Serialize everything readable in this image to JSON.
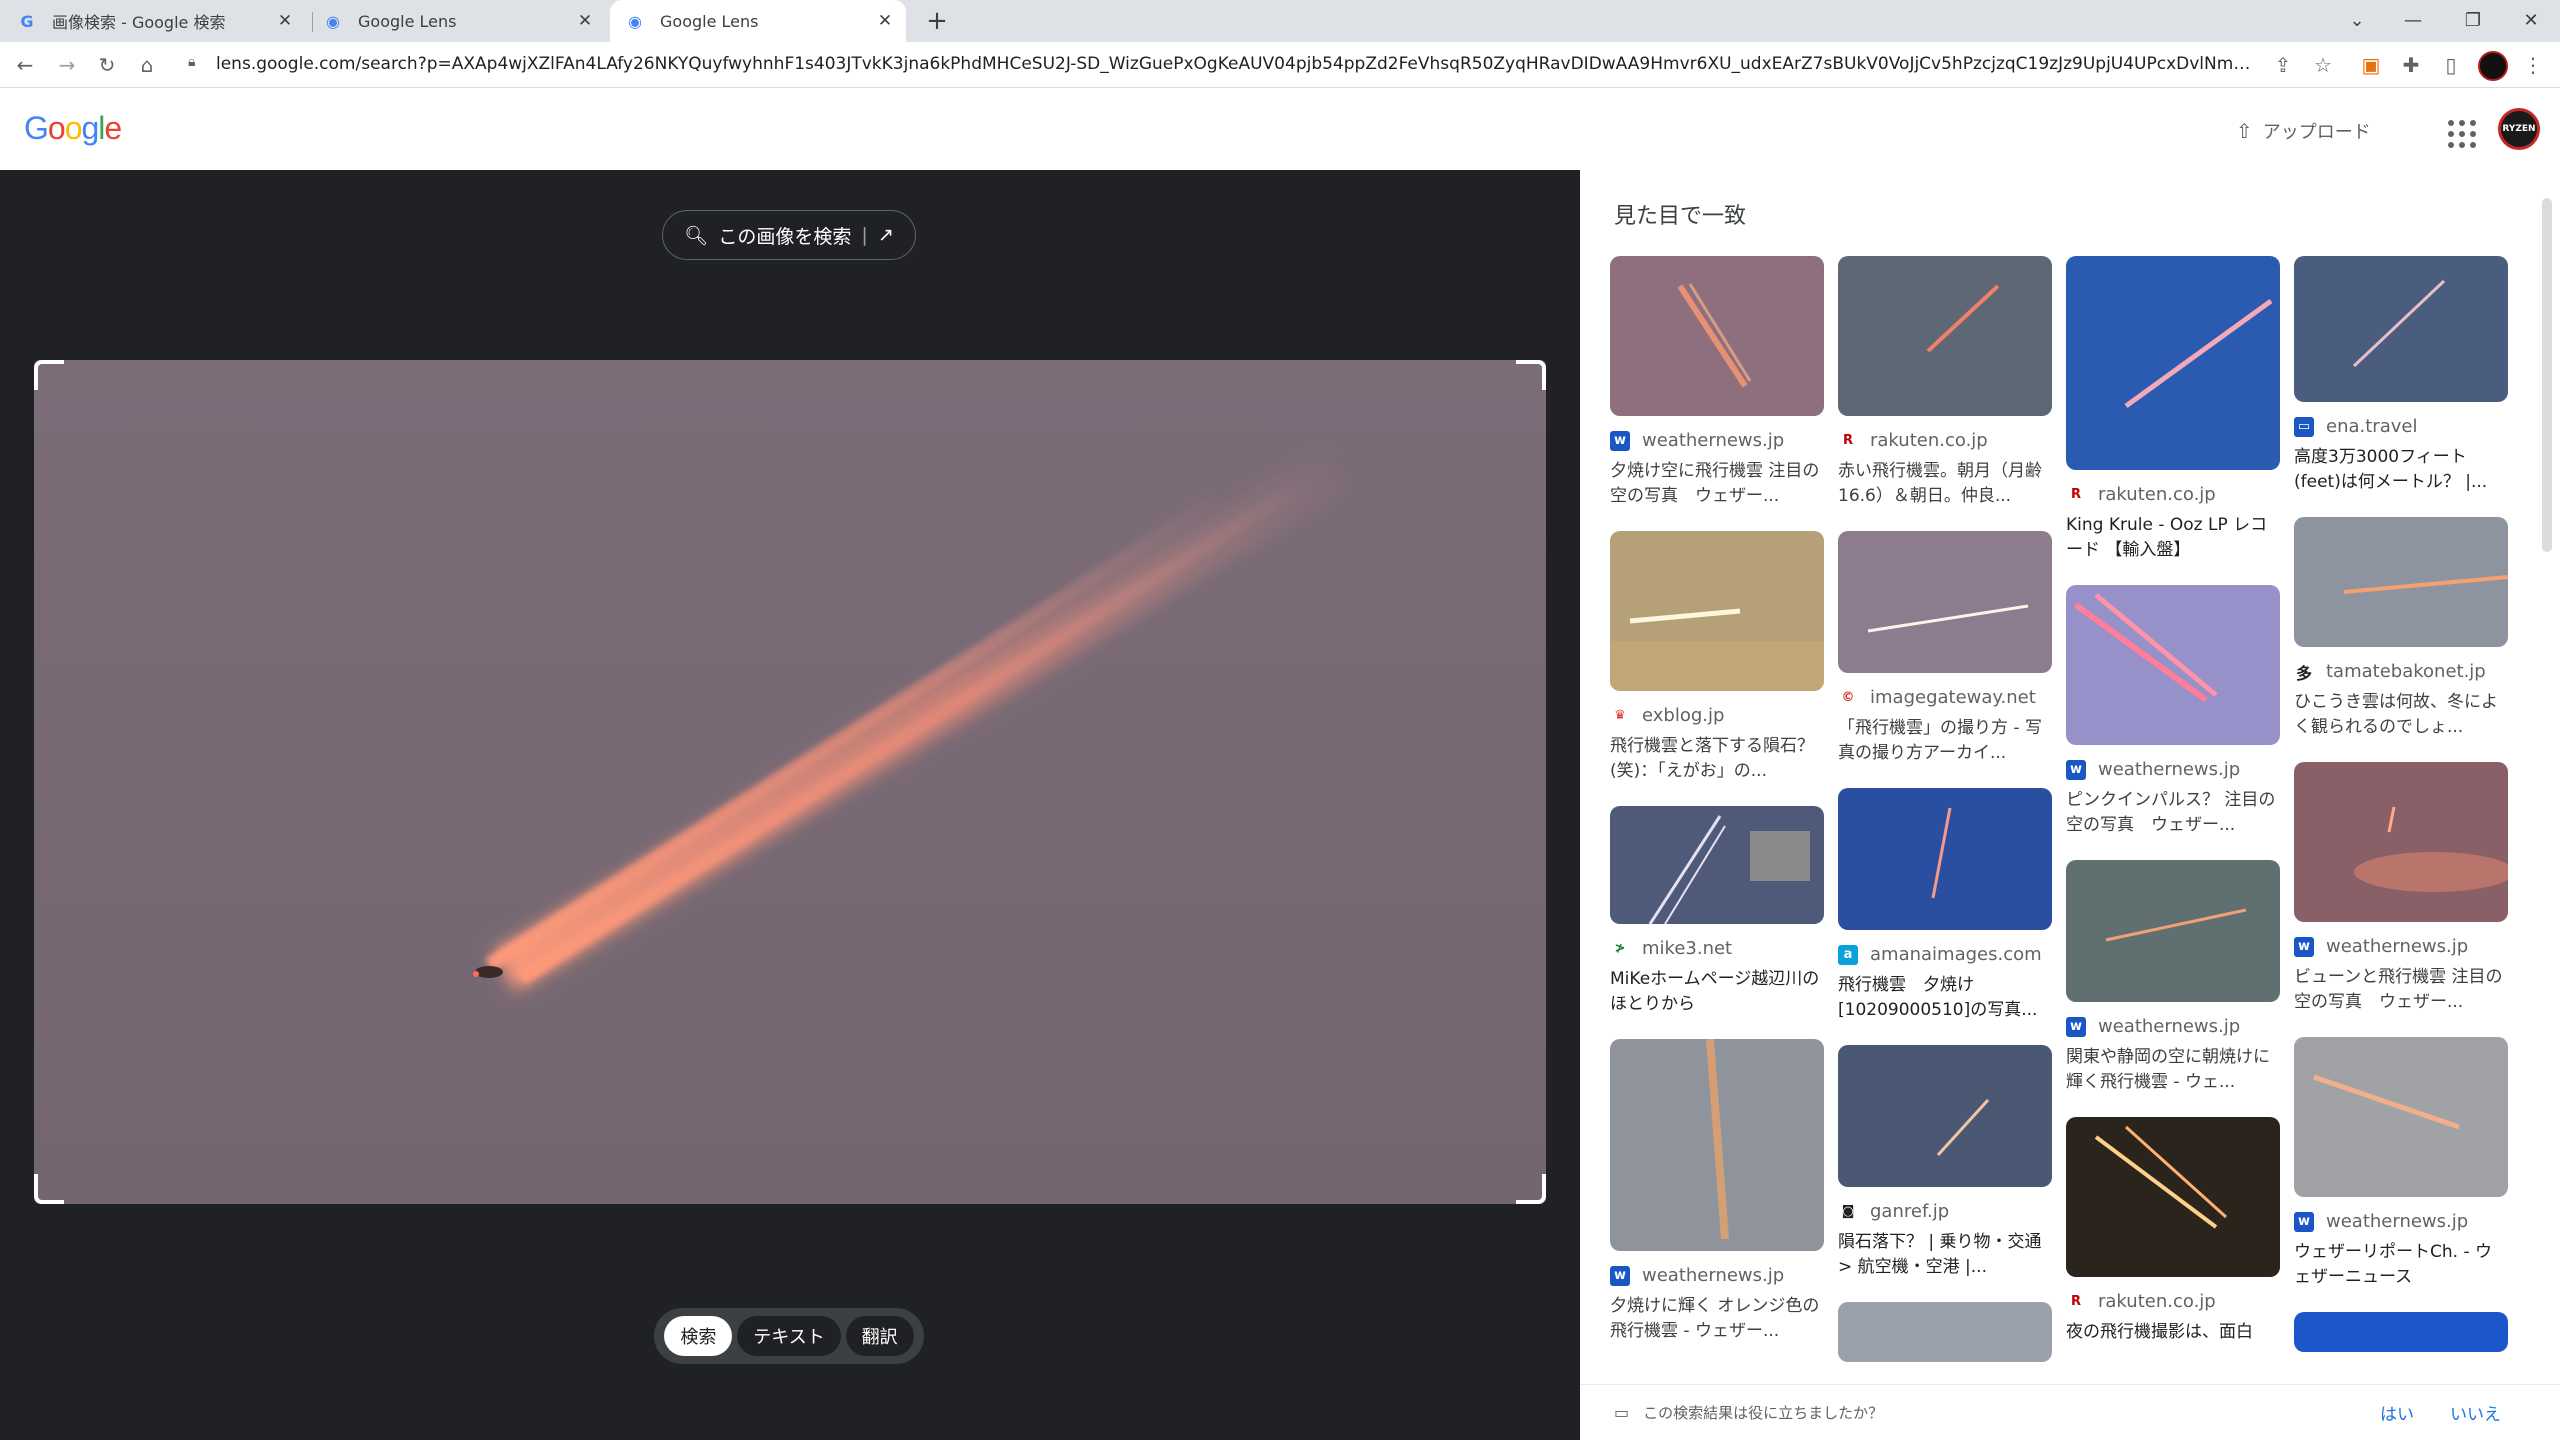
{
  "browser": {
    "tabs": [
      {
        "title": "画像検索 - Google 検索",
        "favicon": "G"
      },
      {
        "title": "Google Lens",
        "favicon": "◉"
      },
      {
        "title": "Google Lens",
        "favicon": "◉"
      }
    ],
    "address": "lens.google.com/search?p=AXAp4wjXZlFAn4LAfy26NKYQuyfwyhnhF1s403JTvkK3jna6kPhdMHCeSU2J-SD_WizGuePxOgKeAUV04pjb54ppZd2FeVhsqR50ZyqHRavDIDwAA9Hmvr6XU_udxEArZ7sBUkV0VoJjCv5hPzcjzqC19zJz9UpjU4UPcxDvlNmuyx4eRPT2EtqiG4bDJu..."
  },
  "header": {
    "logo": "Google",
    "upload_label": "アップロード"
  },
  "viewer": {
    "search_image_label": "この画像を検索",
    "modes": [
      "検索",
      "テキスト",
      "翻訳"
    ]
  },
  "results": {
    "title": "見た目で一致",
    "columns": [
      [
        {
          "source": "weathernews.jp",
          "title": "夕焼け空に飛行機雲 注目の空の写真　ウェザー..."
        },
        {
          "source": "exblog.jp",
          "title": "飛行機雲と落下する隕石？(笑)：「えがお」の..."
        },
        {
          "source": "mike3.net",
          "title": "MiKeホームページ越辺川のほとりから"
        },
        {
          "source": "weathernews.jp",
          "title": "夕焼けに輝く オレンジ色の飛行機雲 - ウェザー..."
        }
      ],
      [
        {
          "source": "rakuten.co.jp",
          "title": "赤い飛行機雲。朝月（月齢 16.6）＆朝日。仲良..."
        },
        {
          "source": "imagegateway.net",
          "title": "「飛行機雲」の撮り方 - 写真の撮り方アーカイ..."
        },
        {
          "source": "amanaimages.com",
          "title": "飛行機雲　夕焼け [10209000510]の写真..."
        },
        {
          "source": "ganref.jp",
          "title": "隕石落下？ | 乗り物・交通 > 航空機・空港 |..."
        }
      ],
      [
        {
          "source": "rakuten.co.jp",
          "title": "King Krule - Ooz LP レコード 【輸入盤】"
        },
        {
          "source": "weathernews.jp",
          "title": "ピンクインパルス？ 注目の空の写真　ウェザー..."
        },
        {
          "source": "weathernews.jp",
          "title": "関東や静岡の空に朝焼けに輝く飛行機雲 - ウェ..."
        },
        {
          "source": "rakuten.co.jp",
          "title": "夜の飛行機撮影は、面白い！大地と遊ぶ自由想..."
        }
      ],
      [
        {
          "source": "ena.travel",
          "title": "高度3万3000フィート(feet)は何メートル？ |..."
        },
        {
          "source": "tamatebakonet.jp",
          "title": "ひこうき雲は何故、冬によく観られるのでしょ..."
        },
        {
          "source": "weathernews.jp",
          "title": "ビューンと飛行機雲 注目の空の写真　ウェザー..."
        },
        {
          "source": "weathernews.jp",
          "title": "ウェザーリポートCh. - ウェザーニュース"
        }
      ]
    ]
  },
  "feedback": {
    "question": "この検索結果は役に立ちましたか？",
    "yes": "はい",
    "no": "いいえ"
  }
}
